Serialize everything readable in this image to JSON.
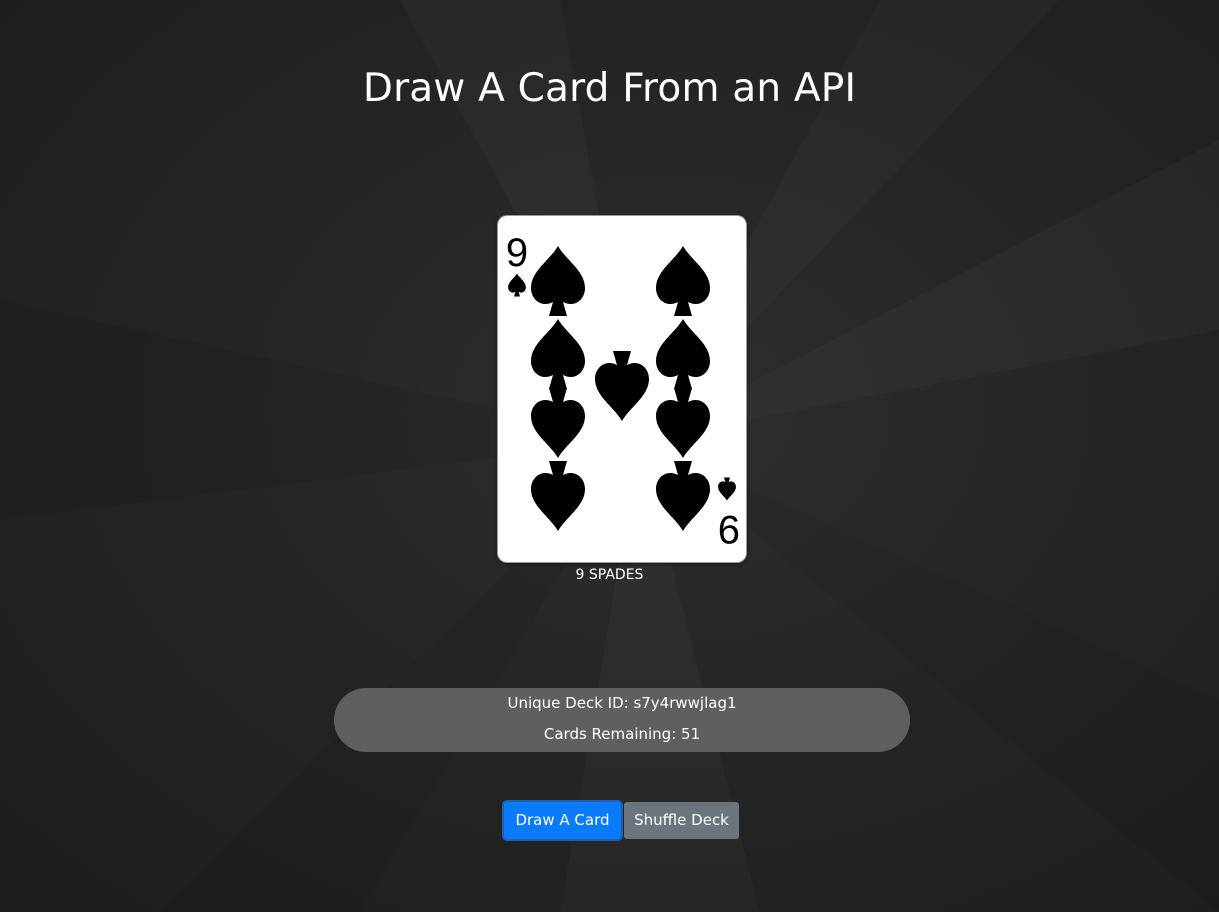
{
  "page": {
    "title": "Draw A Card From an API"
  },
  "card": {
    "rank": "9",
    "suit": "spade",
    "caption": "9 SPADES"
  },
  "deck": {
    "id_label": "Unique Deck ID: s7y4rwwjlag1",
    "remaining_label": "Cards Remaining: 51"
  },
  "buttons": {
    "draw_label": "Draw A Card",
    "shuffle_label": "Shuffle Deck"
  },
  "colors": {
    "draw_button": "#0a7bff",
    "shuffle_button": "#6c757d",
    "info_panel": "#5f5f5f"
  }
}
